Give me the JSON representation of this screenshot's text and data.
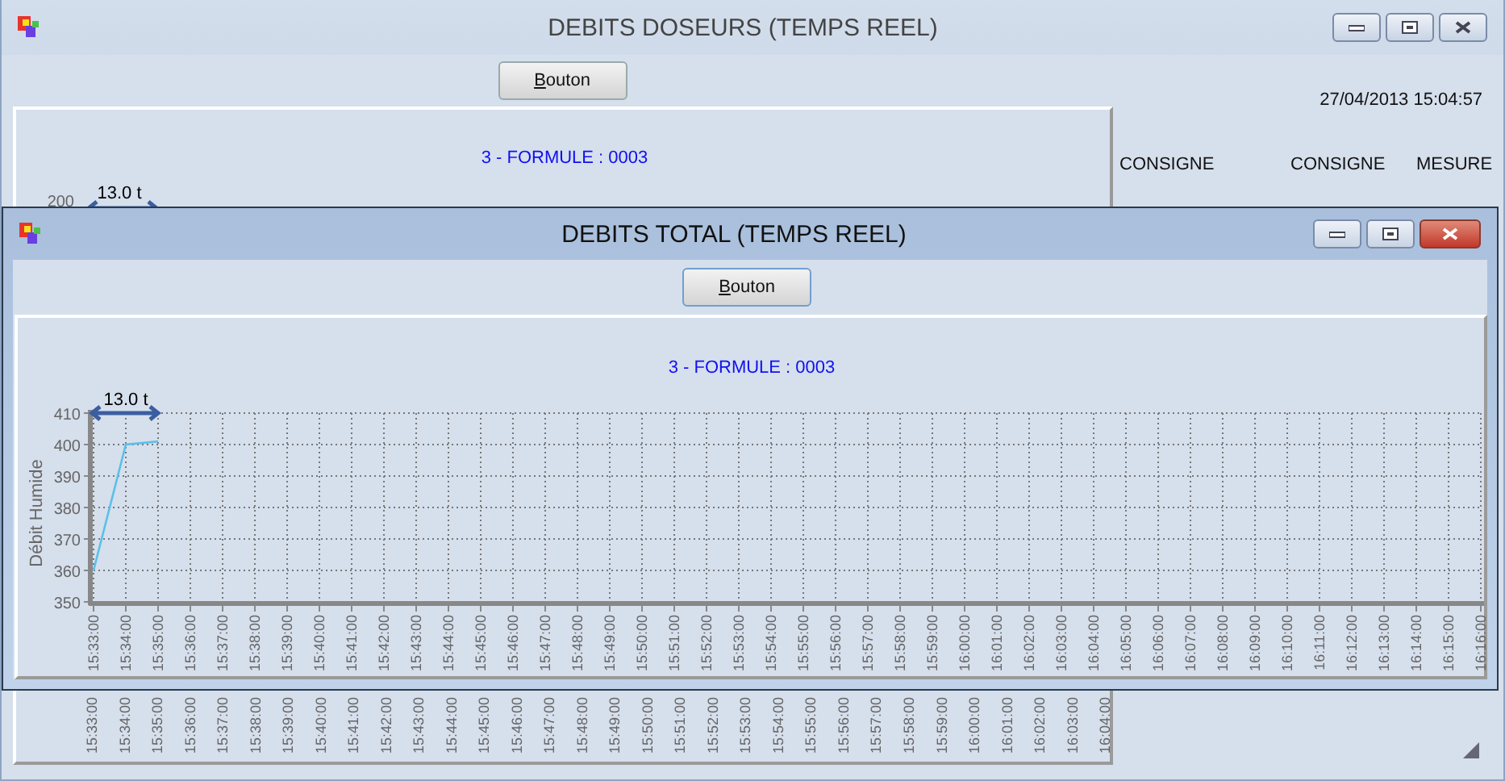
{
  "back_window": {
    "title": "DEBITS DOSEURS (TEMPS REEL)",
    "button": "Bouton",
    "chart": {
      "subtitle": "3 - FORMULE : 0003",
      "span_label": "13.0 t",
      "y_tick": "200",
      "x_labels": [
        "15:33:00",
        "15:34:00",
        "15:35:00",
        "15:36:00",
        "15:37:00",
        "15:38:00",
        "15:39:00",
        "15:40:00",
        "15:41:00",
        "15:42:00",
        "15:43:00",
        "15:44:00",
        "15:45:00",
        "15:46:00",
        "15:47:00",
        "15:48:00",
        "15:49:00",
        "15:50:00",
        "15:51:00",
        "15:52:00",
        "15:53:00",
        "15:54:00",
        "15:55:00",
        "15:56:00",
        "15:57:00",
        "15:58:00",
        "15:59:00",
        "16:00:00",
        "16:01:00",
        "16:02:00",
        "16:03:00",
        "16:04:00"
      ]
    },
    "timestamp": "27/04/2013 15:04:57",
    "columns": [
      "CONSIGNE",
      "CONSIGNE",
      "MESURE"
    ]
  },
  "front_window": {
    "title": "DEBITS TOTAL (TEMPS REEL)",
    "button": "Bouton",
    "chart": {
      "subtitle": "3 - FORMULE : 0003",
      "span_label": "13.0 t",
      "chart_data": {
        "type": "line",
        "ylabel": "Débit Humide",
        "categories": [
          "15:33:00",
          "15:34:00",
          "15:35:00",
          "15:36:00",
          "15:37:00",
          "15:38:00",
          "15:39:00",
          "15:40:00",
          "15:41:00",
          "15:42:00",
          "15:43:00",
          "15:44:00",
          "15:45:00",
          "15:46:00",
          "15:47:00",
          "15:48:00",
          "15:49:00",
          "15:50:00",
          "15:51:00",
          "15:52:00",
          "15:53:00",
          "15:54:00",
          "15:55:00",
          "15:56:00",
          "15:57:00",
          "15:58:00",
          "15:59:00",
          "16:00:00",
          "16:01:00",
          "16:02:00",
          "16:03:00",
          "16:04:00",
          "16:05:00",
          "16:06:00",
          "16:07:00",
          "16:08:00",
          "16:09:00",
          "16:10:00",
          "16:11:00",
          "16:12:00",
          "16:13:00",
          "16:14:00",
          "16:15:00",
          "16:16:00"
        ],
        "series": [
          {
            "color": "#5bc0e8",
            "values": [
              360,
              400,
              401,
              null,
              null,
              null,
              null,
              null,
              null,
              null,
              null,
              null,
              null,
              null,
              null,
              null,
              null,
              null,
              null,
              null,
              null,
              null,
              null,
              null,
              null,
              null,
              null,
              null,
              null,
              null,
              null,
              null,
              null,
              null,
              null,
              null,
              null,
              null,
              null,
              null,
              null,
              null,
              null,
              null
            ]
          }
        ],
        "grid": true,
        "ylim": [
          350,
          410
        ],
        "yticks": [
          350,
          360,
          370,
          380,
          390,
          400,
          410
        ]
      }
    }
  }
}
